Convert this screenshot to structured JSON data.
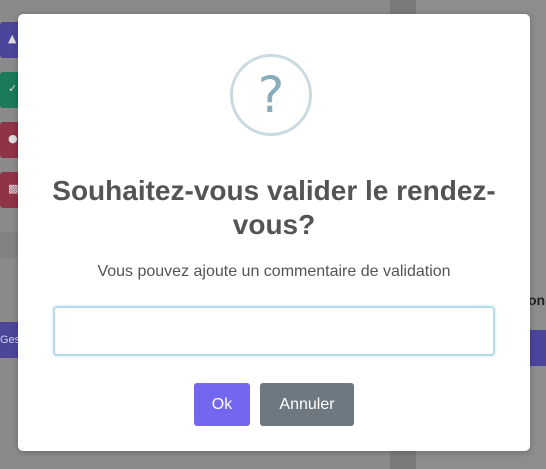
{
  "background": {
    "left_label_partial": "Ges",
    "right_label_partial": "on",
    "icons": [
      "chevron-up-icon",
      "check-icon",
      "info-icon",
      "trash-icon"
    ]
  },
  "dialog": {
    "icon": "?",
    "icon_name": "question-icon",
    "title": "Souhaitez-vous valider le rendez-vous?",
    "message": "Vous pouvez ajoute un commentaire de validation",
    "input": {
      "value": "",
      "placeholder": ""
    },
    "confirm_label": "Ok",
    "cancel_label": "Annuler"
  },
  "colors": {
    "confirm": "#7367f0",
    "cancel": "#6e7881",
    "icon_border": "#c9dae1",
    "icon_glyph": "#87adbd",
    "input_focus_border": "#b4dbed"
  }
}
